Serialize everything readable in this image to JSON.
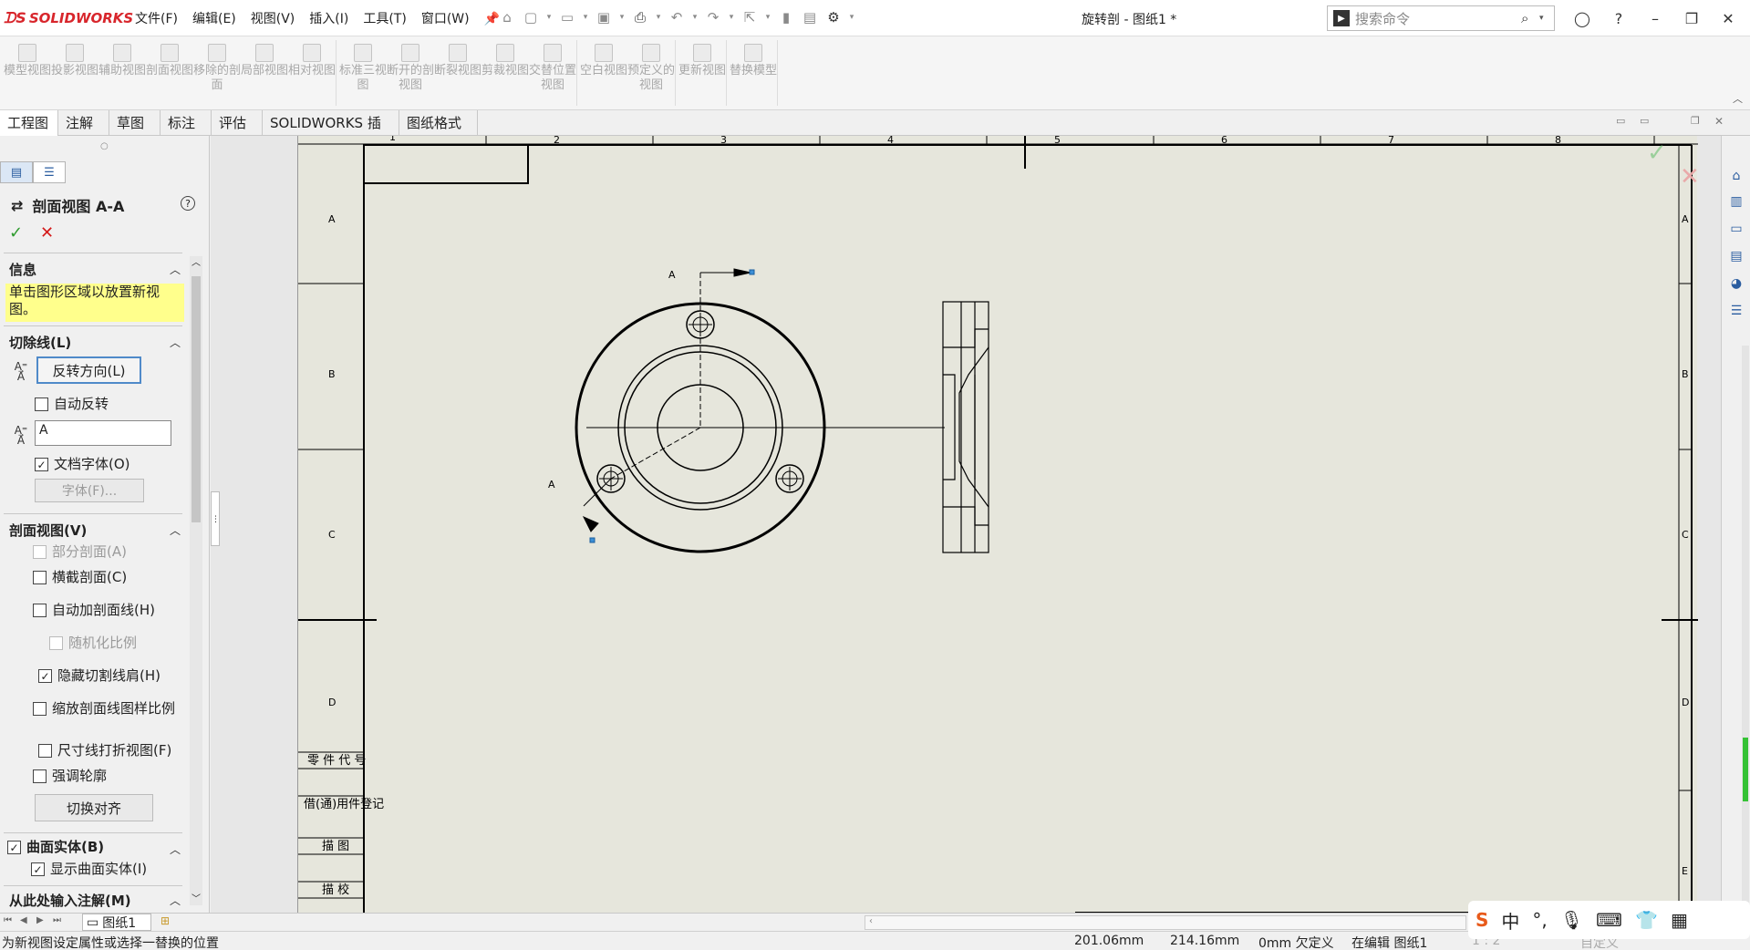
{
  "app": {
    "name": "SOLIDWORKS",
    "doc_title": "旋转剖 - 图纸1 *"
  },
  "menu": [
    "文件(F)",
    "编辑(E)",
    "视图(V)",
    "插入(I)",
    "工具(T)",
    "窗口(W)"
  ],
  "search": {
    "placeholder": "搜索命令"
  },
  "ribbon": {
    "groups": [
      [
        {
          "label": "模型视图",
          "icon": "model-view-icon"
        },
        {
          "label": "投影视图",
          "icon": "projected-view-icon"
        },
        {
          "label": "辅助视图",
          "icon": "auxiliary-view-icon"
        },
        {
          "label": "剖面视图",
          "icon": "section-view-icon"
        },
        {
          "label": "移除的剖面",
          "icon": "removed-section-icon"
        },
        {
          "label": "局部视图",
          "icon": "detail-view-icon"
        },
        {
          "label": "相对视图",
          "icon": "relative-view-icon"
        }
      ],
      [
        {
          "label": "标准三视图",
          "icon": "standard-3-view-icon"
        },
        {
          "label": "断开的剖视图",
          "icon": "broken-out-section-icon"
        },
        {
          "label": "断裂视图",
          "icon": "break-view-icon"
        },
        {
          "label": "剪裁视图",
          "icon": "crop-view-icon"
        },
        {
          "label": "交替位置视图",
          "icon": "alternate-position-icon"
        }
      ],
      [
        {
          "label": "空白视图",
          "icon": "empty-view-icon"
        },
        {
          "label": "预定义的视图",
          "icon": "predefined-view-icon"
        }
      ],
      [
        {
          "label": "更新视图",
          "icon": "update-views-icon"
        }
      ],
      [
        {
          "label": "替换模型",
          "icon": "replace-model-icon"
        }
      ]
    ]
  },
  "tabs": [
    "工程图",
    "注解",
    "草图",
    "标注",
    "评估",
    "SOLIDWORKS 插件",
    "图纸格式"
  ],
  "panel": {
    "title": "剖面视图 A-A",
    "info_header": "信息",
    "info_text": "单击图形区域以放置新视图。",
    "cutline_header": "切除线(L)",
    "flip_button": "反转方向(L)",
    "auto_flip": "自动反转",
    "label_value": "A",
    "doc_font": "文档字体(O)",
    "font_button": "字体(F)...",
    "section_header": "剖面视图(V)",
    "partial": "部分剖面(A)",
    "slice": "横截剖面(C)",
    "auto_hatch": "自动加剖面线(H)",
    "randomize": "随机化比例",
    "hide_cut": "隐藏切割线肩(H)",
    "scale_hatch": "缩放剖面线图样比例",
    "dim_break": "尺寸线打折视图(F)",
    "emphasize": "强调轮廓",
    "toggle_align": "切换对齐",
    "surface_header": "曲面实体(B)",
    "show_surface": "显示曲面实体(I)",
    "import_header": "从此处输入注解(M)"
  },
  "sheet": {
    "col_labels": [
      "1",
      "2",
      "3",
      "4",
      "5",
      "6",
      "7",
      "8"
    ],
    "row_labels": [
      "A",
      "B",
      "C",
      "D",
      "E"
    ],
    "title_rows": [
      "零 件 代 号",
      "借(通)用件登记",
      "描 图",
      "描 校"
    ],
    "section_label": "A"
  },
  "sheet_tab": "图纸1",
  "status": {
    "message": "为新视图设定属性或选择一替换的位置",
    "x": "201.06mm",
    "y": "214.16mm",
    "z": "0mm 欠定义",
    "mode": "在编辑 图纸1",
    "scale": "1 : 2",
    "custom": "自定义"
  },
  "ime": {
    "lang": "中"
  }
}
